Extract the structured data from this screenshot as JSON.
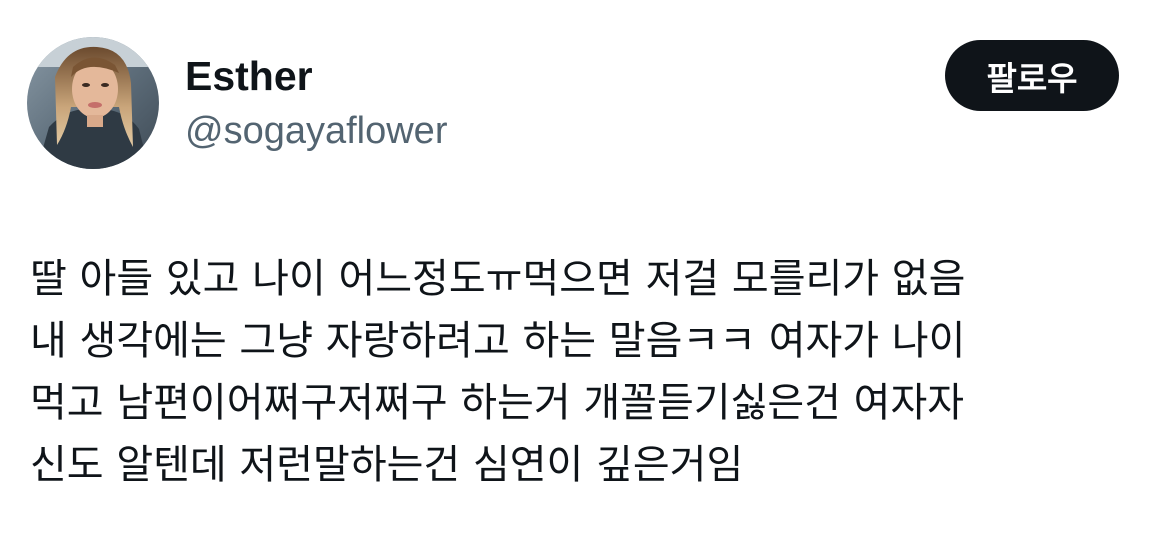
{
  "author": {
    "display_name": "Esther",
    "handle": "@sogayaflower"
  },
  "follow_button": {
    "label": "팔로우"
  },
  "tweet": {
    "lines": [
      "딸 아들 있고 나이 어느정도ㅠ먹으면 저걸 모를리가 없음",
      "내 생각에는 그냥 자랑하려고 하는 말음ㅋㅋ 여자가 나이",
      "먹고 남편이어쩌구저쩌구 하는거 개꼴듣기싫은건 여자자",
      "신도 알텐데 저런말하는건 심연이 깊은거임"
    ]
  },
  "colors": {
    "text_primary": "#0f1419",
    "text_secondary": "#536471",
    "button_bg": "#0f1419",
    "button_text": "#ffffff"
  },
  "icons": {
    "avatar": "profile-photo"
  }
}
